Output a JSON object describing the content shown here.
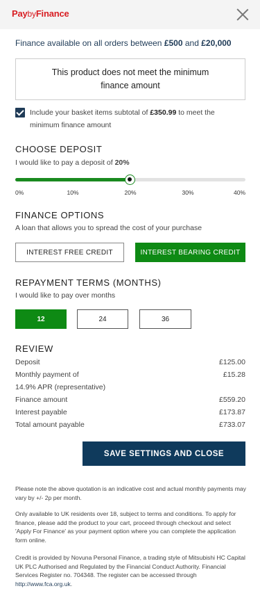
{
  "header": {
    "logo_pay": "Pay",
    "logo_by": "by",
    "logo_finance": "Finance",
    "close_icon": "close-icon"
  },
  "availability": {
    "prefix": "Finance available on all orders between ",
    "min": "£500",
    "and": " and ",
    "max": "£20,000"
  },
  "notice": "This product does not meet the minimum finance amount",
  "basket_option": {
    "checked": true,
    "prefix": "Include your basket items subtotal of ",
    "amount": "£350.99",
    "suffix": " to meet the minimum finance amount"
  },
  "deposit": {
    "title": "CHOOSE DEPOSIT",
    "prefix": "I would like to pay a deposit of ",
    "value": "20%",
    "slider": {
      "min": 0,
      "max": 40,
      "current": 20
    },
    "ticks": [
      "0%",
      "10%",
      "20%",
      "30%",
      "40%"
    ]
  },
  "finance_options": {
    "title": "FINANCE OPTIONS",
    "subtitle": "A loan that allows you to spread the cost of your purchase",
    "options": [
      {
        "label": "INTEREST FREE CREDIT",
        "active": false
      },
      {
        "label": "INTEREST BEARING CREDIT",
        "active": true
      }
    ]
  },
  "terms": {
    "title": "REPAYMENT TERMS (MONTHS)",
    "subtitle": "I would like to pay over months",
    "options": [
      {
        "label": "12",
        "active": true
      },
      {
        "label": "24",
        "active": false
      },
      {
        "label": "36",
        "active": false
      }
    ]
  },
  "review": {
    "title": "REVIEW",
    "rows": [
      {
        "label": "Deposit",
        "value": "£125.00"
      },
      {
        "label": "Monthly payment of",
        "value": "£15.28"
      },
      {
        "label": "14.9% APR (representative)",
        "value": ""
      },
      {
        "label": "Finance amount",
        "value": "£559.20"
      },
      {
        "label": "Interest payable",
        "value": "£173.87"
      },
      {
        "label": "Total amount payable",
        "value": "£733.07"
      }
    ]
  },
  "save_button": "SAVE SETTINGS AND CLOSE",
  "fine_print": {
    "p1": "Please note the above quotation is an indicative cost and actual monthly payments may vary by +/- 2p per month.",
    "p2": "Only available to UK residents over 18, subject to terms and conditions. To apply for finance, please add the product to your cart, proceed through checkout and select 'Apply For Finance' as your payment option where you can complete the application form online.",
    "p3": "Credit is provided by Novuna Personal Finance, a trading style of Mitsubishi HC Capital UK PLC Authorised and Regulated by the Financial Conduct Authority. Financial Services Register no. 704348. The register can be accessed through ",
    "link": "http://www.fca.org.uk",
    "link_suffix": "."
  },
  "colors": {
    "brand_red": "#d81e23",
    "accent_green": "#0e8a14",
    "navy": "#0f3a5c"
  }
}
